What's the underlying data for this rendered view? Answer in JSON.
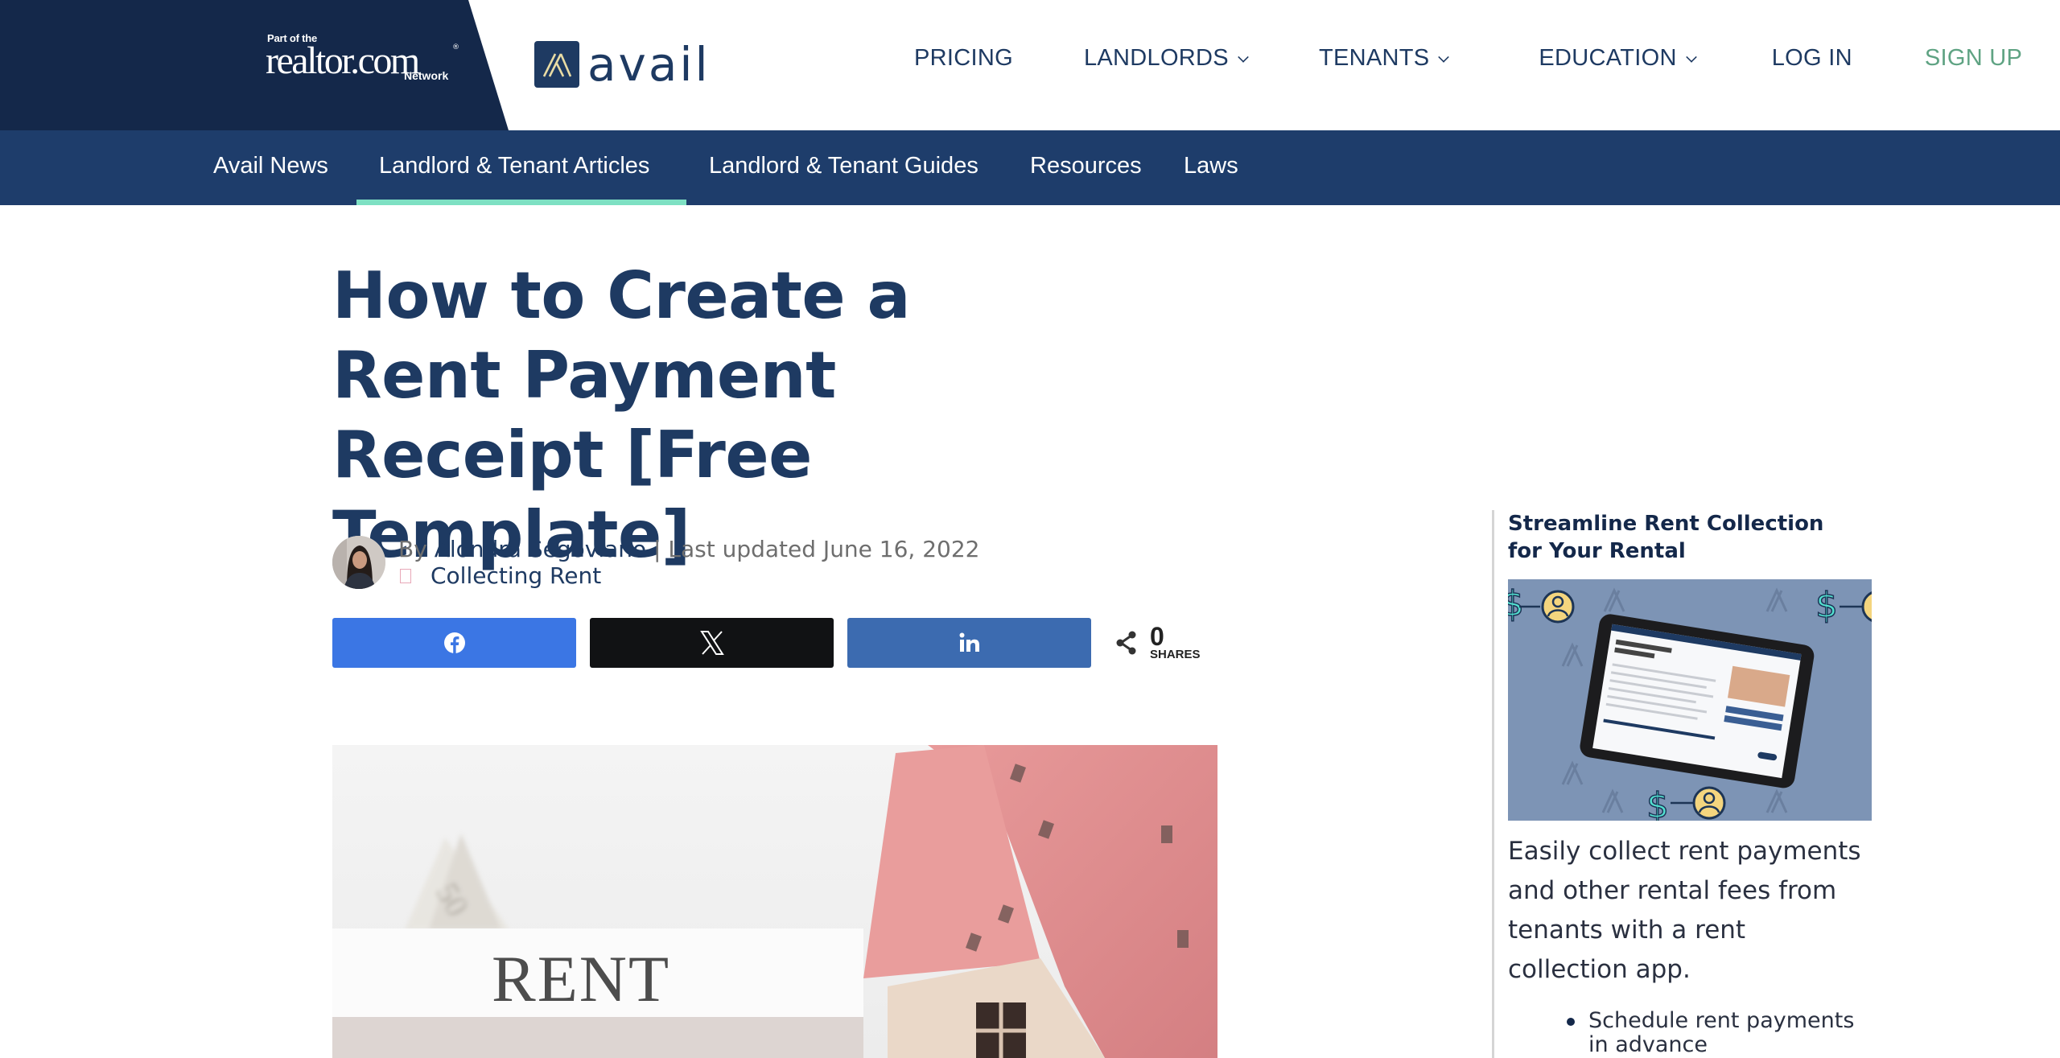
{
  "header": {
    "realtor_logo": {
      "pre": "Part of the",
      "brand": "realtor.com",
      "registered": "®",
      "network": "Network"
    },
    "avail_logo": {
      "word": "avail"
    },
    "nav": [
      {
        "label": "PRICING",
        "dropdown": false
      },
      {
        "label": "LANDLORDS",
        "dropdown": true
      },
      {
        "label": "TENANTS",
        "dropdown": true
      },
      {
        "label": "EDUCATION",
        "dropdown": true
      },
      {
        "label": "LOG IN",
        "dropdown": false
      },
      {
        "label": "SIGN UP",
        "dropdown": false
      }
    ]
  },
  "subnav": {
    "items": [
      {
        "label": "Avail News"
      },
      {
        "label": "Landlord & Tenant Articles",
        "active": true
      },
      {
        "label": "Landlord & Tenant Guides"
      },
      {
        "label": "Resources"
      },
      {
        "label": "Laws"
      }
    ]
  },
  "article": {
    "title": "How to Create a Rent Payment Receipt [Free Template]",
    "byline": {
      "by": "By ",
      "author": "Alondra Segoviano",
      "separator": " | ",
      "updated": "Last updated June 16, 2022",
      "category": "Collecting Rent"
    },
    "share": {
      "buttons": [
        {
          "network": "facebook",
          "icon": "facebook-icon"
        },
        {
          "network": "x",
          "icon": "x-icon"
        },
        {
          "network": "linkedin",
          "icon": "linkedin-icon"
        }
      ],
      "count": "0",
      "count_label": "SHARES"
    },
    "hero_image": {
      "caption_text": "RENT",
      "alt": "Rent sign with dollar bill and wooden house model"
    }
  },
  "sidebar": {
    "title": "Streamline Rent Collection for Your Rental",
    "image_alt": "Tablet showing rent collection app with dollar-to-tenant icons",
    "text": "Easily collect rent payments and other rental fees from tenants with a rent collection app.",
    "list": [
      "Schedule rent payments in advance"
    ]
  },
  "colors": {
    "navy_dark": "#14284a",
    "navy": "#1e3a62",
    "subnav_bg": "#1e3d6b",
    "active_underline": "#7ee0c3",
    "signup_green": "#5fa383",
    "facebook": "#3b76e4",
    "x": "#111214",
    "linkedin": "#3c6bb0"
  }
}
